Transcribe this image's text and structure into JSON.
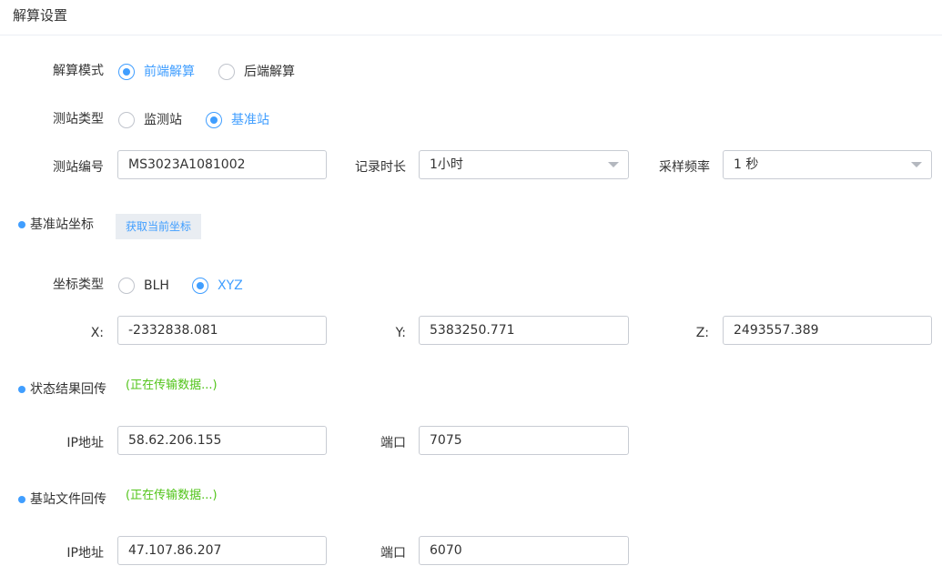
{
  "header": {
    "title": "解算设置"
  },
  "solve_mode": {
    "label": "解算模式",
    "options": [
      {
        "label": "前端解算",
        "checked": true
      },
      {
        "label": "后端解算",
        "checked": false
      }
    ]
  },
  "station_type": {
    "label": "测站类型",
    "options": [
      {
        "label": "监测站",
        "checked": false
      },
      {
        "label": "基准站",
        "checked": true
      }
    ]
  },
  "station_id": {
    "label": "测站编号",
    "value": "MS3023A1081002"
  },
  "record_duration": {
    "label": "记录时长",
    "value": "1小时"
  },
  "sample_rate": {
    "label": "采样频率",
    "value": "1 秒"
  },
  "base_coord": {
    "title": "基准站坐标",
    "button": "获取当前坐标",
    "coord_type_label": "坐标类型",
    "coord_options": [
      {
        "label": "BLH",
        "checked": false
      },
      {
        "label": "XYZ",
        "checked": true
      }
    ],
    "x_label": "X:",
    "x_value": "-2332838.081",
    "y_label": "Y:",
    "y_value": "5383250.771",
    "z_label": "Z:",
    "z_value": "2493557.389"
  },
  "status_return": {
    "title": "状态结果回传",
    "status": "(正在传输数据...)",
    "ip_label": "IP地址",
    "ip_value": "58.62.206.155",
    "port_label": "端口",
    "port_value": "7075"
  },
  "file_return": {
    "title": "基站文件回传",
    "status": "(正在传输数据...)",
    "ip_label": "IP地址",
    "ip_value": "47.107.86.207",
    "port_label": "端口",
    "port_value": "6070"
  },
  "colors": {
    "accent": "#409eff",
    "status_green": "#52c41a",
    "border": "#c8ccd3"
  },
  "icons": {
    "radio": "radio-circle",
    "select": "chevron-down-icon",
    "section": "bullet-dot-icon"
  }
}
